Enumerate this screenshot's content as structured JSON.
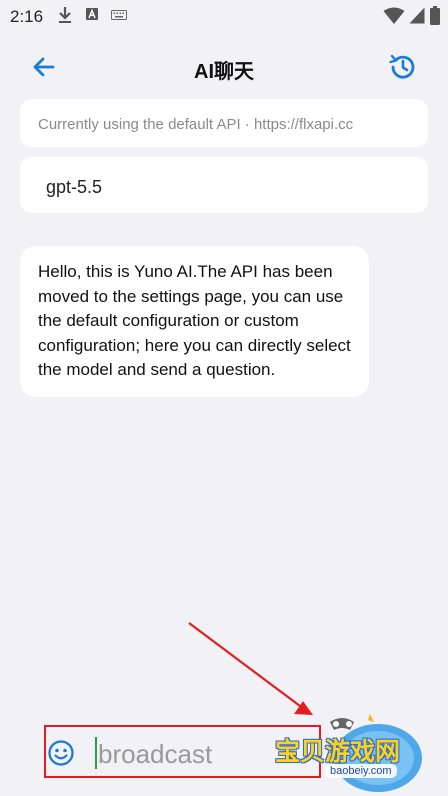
{
  "status_bar": {
    "time": "2:16"
  },
  "app_bar": {
    "title": "AI聊天"
  },
  "api_info": {
    "text": "Currently using the default API · https://flxapi.cc"
  },
  "model": {
    "name": "gpt-5.5"
  },
  "messages": [
    {
      "role": "assistant",
      "text": "Hello, this is Yuno AI.The API has been moved to the settings page, you can use the default configuration or custom configuration; here you can directly select the model and send a question."
    }
  ],
  "composer": {
    "placeholder": "broadcast",
    "value": ""
  },
  "watermark": {
    "brand": "宝贝游戏网",
    "url": "baobeiy.com"
  },
  "colors": {
    "accent": "#1a7bd9",
    "background": "#f1f1f6",
    "annotation": "#e02020"
  }
}
